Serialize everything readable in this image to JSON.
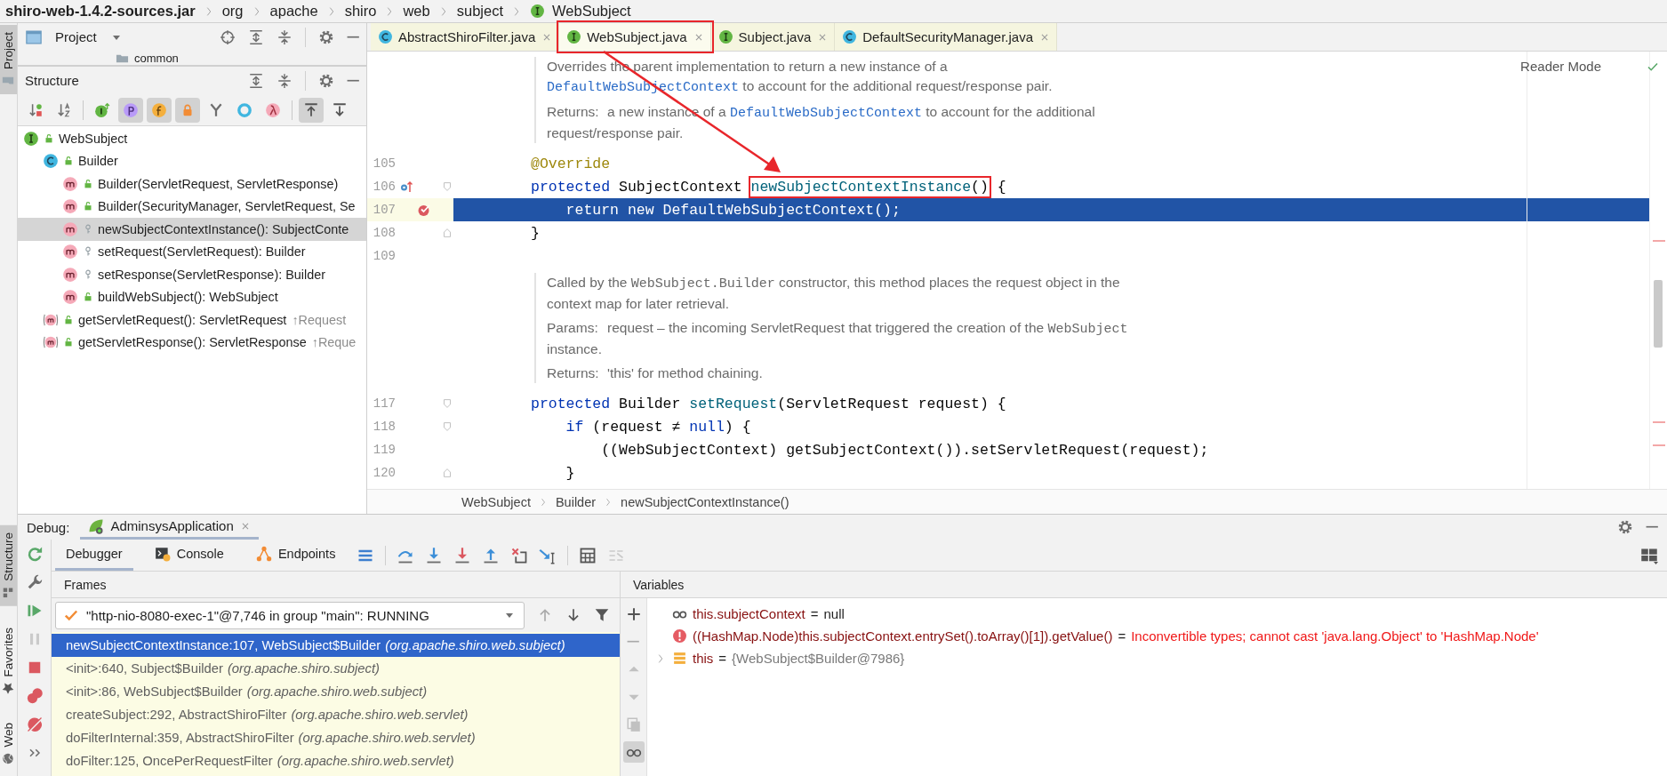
{
  "breadcrumb": [
    {
      "text": "shiro-web-1.4.2-sources.jar",
      "kind": "archive"
    },
    {
      "text": "org",
      "kind": "package"
    },
    {
      "text": "apache",
      "kind": "package"
    },
    {
      "text": "shiro",
      "kind": "package"
    },
    {
      "text": "web",
      "kind": "package"
    },
    {
      "text": "subject",
      "kind": "package"
    },
    {
      "text": "WebSubject",
      "kind": "interface"
    }
  ],
  "tool_windows": {
    "top": [
      {
        "label": "Project",
        "kind": "project",
        "selected": true
      }
    ],
    "bottom": [
      {
        "label": "Structure",
        "kind": "structure",
        "selected": true
      },
      {
        "label": "Favorites",
        "kind": "favorites",
        "selected": false
      },
      {
        "label": "Web",
        "kind": "web",
        "selected": false
      }
    ]
  },
  "project_panel": {
    "title": "Project",
    "partial_row": "common"
  },
  "structure": {
    "title": "Structure",
    "toolbar": [
      {
        "kind": "sort-visibility",
        "selected": false
      },
      {
        "kind": "sort-alpha",
        "selected": false
      },
      {
        "kind": "separator"
      },
      {
        "kind": "inherited",
        "selected": false
      },
      {
        "kind": "properties",
        "selected": true
      },
      {
        "kind": "fields",
        "selected": true
      },
      {
        "kind": "non-public",
        "selected": true
      },
      {
        "kind": "anonymous",
        "selected": false
      },
      {
        "kind": "ring",
        "selected": false
      },
      {
        "kind": "lambda",
        "selected": false
      },
      {
        "kind": "separator"
      },
      {
        "kind": "scroll-to-source",
        "selected": true
      },
      {
        "kind": "scroll-from-source",
        "selected": false
      }
    ],
    "tree": [
      {
        "text": "WebSubject",
        "kind": "interface",
        "public": true,
        "selected": false,
        "children": [
          {
            "text": "Builder",
            "kind": "class",
            "public": true,
            "selected": false,
            "children": [
              {
                "text": "Builder(ServletRequest, ServletResponse)",
                "kind": "method",
                "public": true,
                "selected": false
              },
              {
                "text": "Builder(SecurityManager, ServletRequest, Se",
                "kind": "method",
                "public": true,
                "selected": false
              },
              {
                "text": "newSubjectContextInstance(): SubjectConte",
                "kind": "method",
                "public": false,
                "selected": true
              },
              {
                "text": "setRequest(ServletRequest): Builder",
                "kind": "method",
                "public": false,
                "selected": false
              },
              {
                "text": "setResponse(ServletResponse): Builder",
                "kind": "method",
                "public": false,
                "selected": false
              },
              {
                "text": "buildWebSubject(): WebSubject",
                "kind": "method",
                "public": true,
                "selected": false
              }
            ]
          },
          {
            "text": "getServletRequest(): ServletRequest",
            "kind": "inherited-method",
            "public": true,
            "selected": false,
            "inherited_from": "↑Request"
          },
          {
            "text": "getServletResponse(): ServletResponse",
            "kind": "inherited-method",
            "public": true,
            "selected": false,
            "inherited_from": "↑Reque"
          }
        ]
      }
    ]
  },
  "editor": {
    "tabs": [
      {
        "label": "AbstractShiroFilter.java",
        "kind": "class",
        "selected": false,
        "outlined": false
      },
      {
        "label": "WebSubject.java",
        "kind": "interface",
        "selected": true,
        "outlined": true
      },
      {
        "label": "Subject.java",
        "kind": "interface",
        "selected": false,
        "outlined": false
      },
      {
        "label": "DefaultSecurityManager.java",
        "kind": "class",
        "selected": false,
        "outlined": false
      }
    ],
    "reader_mode": "Reader Mode",
    "callout_arrow": true,
    "lines": [
      {
        "kind": "doc",
        "paragraphs": [
          {
            "lines": [
              [
                {
                  "text": "Overrides the parent implementation to return a new instance of a",
                  "kind": "plain"
                }
              ],
              [
                {
                  "text": "DefaultWebSubjectContext",
                  "kind": "link"
                },
                {
                  "text": " to account for the additional request/response pair.",
                  "kind": "plain"
                }
              ]
            ]
          },
          {
            "label": "Returns:",
            "lines": [
              [
                {
                  "text": "a new instance of a ",
                  "kind": "plain"
                },
                {
                  "text": "DefaultWebSubjectContext",
                  "kind": "link"
                },
                {
                  "text": " to account for the additional",
                  "kind": "plain"
                }
              ],
              [
                {
                  "text": "request/response pair.",
                  "kind": "plain"
                }
              ]
            ]
          }
        ]
      },
      {
        "kind": "code",
        "number": "105",
        "current": false,
        "segments": [
          {
            "text": "@Override",
            "kind": "annotation"
          }
        ]
      },
      {
        "kind": "code",
        "number": "106",
        "current": false,
        "overridden": true,
        "fold_start": true,
        "segments": [
          {
            "text": "protected",
            "kind": "keyword"
          },
          {
            "text": " SubjectContext ",
            "kind": "plain"
          },
          {
            "text": "newSubjectContextInstance",
            "kind": "method",
            "outlined": true
          },
          {
            "text": "()",
            "kind": "plain",
            "outlined": true
          },
          {
            "text": " {",
            "kind": "plain"
          }
        ]
      },
      {
        "kind": "code",
        "number": "107",
        "current": true,
        "breakpoint": true,
        "segments": [
          {
            "text": "    return new",
            "kind": "keyword"
          },
          {
            "text": " DefaultWebSubjectContext();",
            "kind": "plain"
          }
        ]
      },
      {
        "kind": "code",
        "number": "108",
        "current": false,
        "fold_end": true,
        "segments": [
          {
            "text": "}",
            "kind": "plain"
          }
        ]
      },
      {
        "kind": "code",
        "number": "109"
      },
      {
        "kind": "doc",
        "paragraphs": [
          {
            "lines": [
              [
                {
                  "text": "Called by the ",
                  "kind": "plain"
                },
                {
                  "text": "WebSubject.Builder",
                  "kind": "code"
                },
                {
                  "text": " constructor, this method places the request object in the",
                  "kind": "plain"
                }
              ],
              [
                {
                  "text": "context map for later retrieval.",
                  "kind": "plain"
                }
              ]
            ]
          },
          {
            "label": "Params:",
            "lines": [
              [
                {
                  "text": "request – the incoming ServletRequest that triggered the creation of the ",
                  "kind": "plain"
                },
                {
                  "text": "WebSubject",
                  "kind": "code"
                }
              ],
              [
                {
                  "text": "instance.",
                  "kind": "plain"
                }
              ]
            ]
          },
          {
            "label": "Returns:",
            "lines": [
              [
                {
                  "text": "'this' for method chaining.",
                  "kind": "plain"
                }
              ]
            ]
          }
        ]
      },
      {
        "kind": "code",
        "number": "117",
        "current": false,
        "fold_start": true,
        "segments": [
          {
            "text": "protected",
            "kind": "keyword"
          },
          {
            "text": " Builder ",
            "kind": "plain"
          },
          {
            "text": "setRequest",
            "kind": "method"
          },
          {
            "text": "(ServletRequest request) {",
            "kind": "plain"
          }
        ]
      },
      {
        "kind": "code",
        "number": "118",
        "current": false,
        "fold_start": true,
        "segments": [
          {
            "text": "    if",
            "kind": "keyword"
          },
          {
            "text": " (request ≠ ",
            "kind": "plain"
          },
          {
            "text": "null",
            "kind": "keyword"
          },
          {
            "text": ") {",
            "kind": "plain"
          }
        ]
      },
      {
        "kind": "code",
        "number": "119",
        "current": false,
        "segments": [
          {
            "text": "        ((WebSubjectContext) getSubjectContext()).setServletRequest(request);",
            "kind": "plain"
          }
        ]
      },
      {
        "kind": "code",
        "number": "120",
        "current": false,
        "fold_end": true,
        "segments": [
          {
            "text": "    }",
            "kind": "plain"
          }
        ]
      }
    ],
    "breadcrumb": [
      "WebSubject",
      "Builder",
      "newSubjectContextInstance()"
    ]
  },
  "debug": {
    "label": "Debug:",
    "session": {
      "label": "AdminsysApplication",
      "selected": true
    },
    "side_tools": [
      {
        "kind": "rerun",
        "disabled": false
      },
      {
        "kind": "settings",
        "disabled": false
      },
      {
        "kind": "resume",
        "disabled": false
      },
      {
        "kind": "pause",
        "disabled": true
      },
      {
        "kind": "stop",
        "disabled": false
      },
      {
        "kind": "breakpoints",
        "disabled": false
      },
      {
        "kind": "mute",
        "disabled": false
      },
      {
        "kind": "more",
        "disabled": false
      }
    ],
    "tabs": [
      {
        "label": "Debugger",
        "kind": "debugger",
        "selected": true
      },
      {
        "label": "Console",
        "kind": "console",
        "selected": false
      },
      {
        "label": "Endpoints",
        "kind": "endpoints",
        "selected": false
      }
    ],
    "toolbar": [
      {
        "kind": "threads",
        "disabled": false
      },
      {
        "kind": "separator"
      },
      {
        "kind": "step-over",
        "disabled": false
      },
      {
        "kind": "step-into",
        "disabled": false
      },
      {
        "kind": "force-step-into",
        "disabled": false
      },
      {
        "kind": "step-out",
        "disabled": false
      },
      {
        "kind": "drop-frame",
        "disabled": false
      },
      {
        "kind": "run-to-cursor",
        "disabled": false
      },
      {
        "kind": "separator"
      },
      {
        "kind": "evaluate",
        "disabled": false
      },
      {
        "kind": "trace",
        "disabled": true
      }
    ],
    "frames": {
      "title": "Frames",
      "thread": "\"http-nio-8080-exec-1\"@7,746 in group \"main\": RUNNING",
      "tools": [
        {
          "kind": "up",
          "disabled": true
        },
        {
          "kind": "down",
          "disabled": false
        },
        {
          "kind": "filter",
          "disabled": false
        }
      ],
      "rows": [
        {
          "method": "newSubjectContextInstance:107, WebSubject$Builder",
          "package": "(org.apache.shiro.web.subject)",
          "selected": true
        },
        {
          "method": "<init>:640, Subject$Builder",
          "package": "(org.apache.shiro.subject)",
          "selected": false
        },
        {
          "method": "<init>:86, WebSubject$Builder",
          "package": "(org.apache.shiro.web.subject)",
          "selected": false
        },
        {
          "method": "createSubject:292, AbstractShiroFilter",
          "package": "(org.apache.shiro.web.servlet)",
          "selected": false
        },
        {
          "method": "doFilterInternal:359, AbstractShiroFilter",
          "package": "(org.apache.shiro.web.servlet)",
          "selected": false
        },
        {
          "method": "doFilter:125, OncePerRequestFilter",
          "package": "(org.apache.shiro.web.servlet)",
          "selected": false
        }
      ]
    },
    "variables": {
      "title": "Variables",
      "tools": [
        {
          "kind": "add",
          "disabled": false,
          "selected": false
        },
        {
          "kind": "remove",
          "disabled": true,
          "selected": false
        },
        {
          "kind": "move-up",
          "disabled": true,
          "selected": false
        },
        {
          "kind": "move-down",
          "disabled": true,
          "selected": false
        },
        {
          "kind": "duplicate",
          "disabled": true,
          "selected": false
        },
        {
          "kind": "watches",
          "disabled": false,
          "selected": true
        }
      ],
      "rows": [
        {
          "kind": "watch",
          "name": "this.subjectContext",
          "operator": "=",
          "value": "null"
        },
        {
          "kind": "error",
          "name": "((HashMap.Node)this.subjectContext.entrySet().toArray()[1]).getValue()",
          "operator": "=",
          "value": "Inconvertible types; cannot cast 'java.lang.Object' to 'HashMap.Node'"
        },
        {
          "kind": "object",
          "name": "this",
          "operator": "=",
          "value": "{WebSubject$Builder@7986}",
          "expanded": false
        }
      ]
    }
  }
}
